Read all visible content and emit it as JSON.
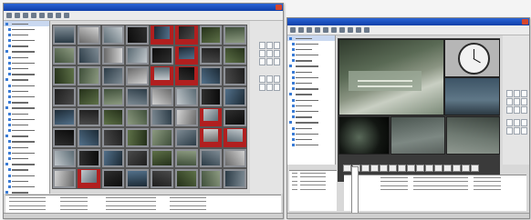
{
  "app": {
    "left_window_title": "",
    "right_window_title": ""
  },
  "left_window": {
    "toolbar_buttons": [
      "tool-1",
      "tool-2",
      "tool-3",
      "tool-4",
      "tool-5",
      "tool-6",
      "tool-7",
      "tool-8"
    ],
    "tree_items": 33,
    "grid": {
      "rows": 8,
      "cols": 8
    },
    "alarm_cells": [
      [
        0,
        4
      ],
      [
        0,
        5
      ],
      [
        1,
        5
      ],
      [
        2,
        4
      ],
      [
        2,
        5
      ],
      [
        4,
        6
      ],
      [
        5,
        6
      ],
      [
        5,
        7
      ],
      [
        7,
        1
      ]
    ],
    "log_rows": 6
  },
  "right_window": {
    "tree_items": 20,
    "playback_buttons": [
      "pb-1",
      "pb-2",
      "pb-3",
      "pb-4",
      "pb-5",
      "pb-6",
      "pb-7",
      "pb-8",
      "pb-9",
      "pb-10",
      "pb-11",
      "pb-12",
      "pb-13",
      "pb-14",
      "pb-15"
    ],
    "log_rows": 4
  },
  "colors": {
    "alarm": "#b11f1f",
    "title_bar": "#1f4fc0",
    "selection": "#c9d8f0"
  }
}
